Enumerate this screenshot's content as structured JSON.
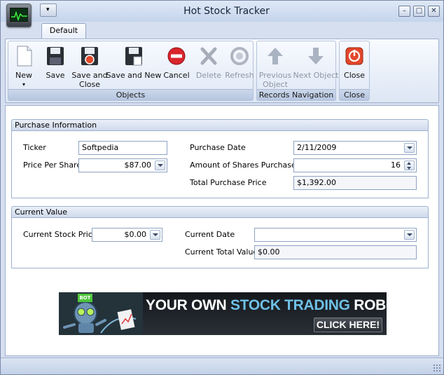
{
  "window": {
    "title": "Hot Stock Tracker"
  },
  "quick_access": {
    "glyph": "▾"
  },
  "window_controls": {
    "minimize": "–",
    "maximize": "□",
    "close": "✕"
  },
  "tabs": [
    {
      "label": "Default"
    }
  ],
  "ribbon": {
    "groups": {
      "objects": "Objects",
      "records_navigation": "Records Navigation",
      "close": "Close"
    },
    "buttons": {
      "new": "New",
      "save": "Save",
      "save_and_close": "Save and Close",
      "save_and_new": "Save and New",
      "cancel": "Cancel",
      "delete": "Delete",
      "refresh": "Refresh",
      "previous_object": "Previous Object",
      "next_object": "Next Object",
      "close": "Close"
    },
    "new_dropdown_glyph": "▾"
  },
  "purchase_information": {
    "header": "Purchase Information",
    "ticker_label": "Ticker",
    "ticker_value": "Softpedia",
    "price_per_share_label": "Price Per Share",
    "price_per_share_value": "$87.00",
    "purchase_date_label": "Purchase Date",
    "purchase_date_value": "2/11/2009",
    "amount_of_shares_label": "Amount of Shares  Purchased",
    "amount_of_shares_value": "16",
    "total_purchase_price_label": "Total Purchase Price",
    "total_purchase_price_value": "$1,392.00"
  },
  "current_value": {
    "header": "Current Value",
    "current_stock_price_label": "Current Stock Price",
    "current_stock_price_value": "$0.00",
    "current_date_label": "Current Date",
    "current_date_value": "",
    "current_total_value_label": "Current Total Value",
    "current_total_value_value": "$0.00"
  },
  "banner": {
    "tag": "BOT",
    "headline_part1": "YOUR OWN ",
    "headline_highlight": "STOCK TRADING",
    "headline_part2": " ROBOT!",
    "cta": "CLICK HERE!"
  },
  "colors": {
    "window_chrome": "#d6dff0",
    "ribbon_group_label": "#b6c6e0",
    "banner_highlight": "#6fc0e6",
    "cancel_red": "#d9262c"
  }
}
